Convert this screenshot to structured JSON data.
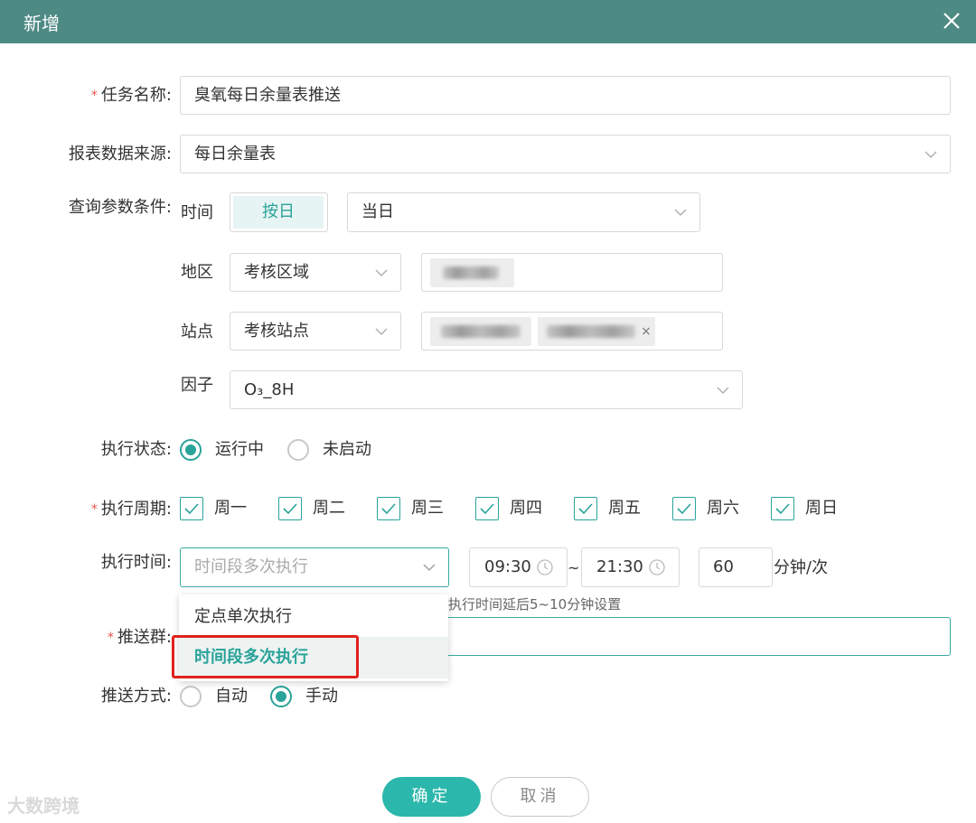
{
  "dialog": {
    "title": "新增"
  },
  "form": {
    "task_name": {
      "label": "任务名称:",
      "value": "臭氧每日余量表推送"
    },
    "report_source": {
      "label": "报表数据来源:",
      "value": "每日余量表"
    },
    "query": {
      "label": "查询参数条件:",
      "time": {
        "label": "时间",
        "button": "按日",
        "value": "当日"
      },
      "region": {
        "label": "地区",
        "type_value": "考核区域"
      },
      "site": {
        "label": "站点",
        "type_value": "考核站点",
        "tag_close": "×"
      },
      "factor": {
        "label": "因子",
        "value": "O₃_8H"
      }
    },
    "exec_status": {
      "label": "执行状态:",
      "options": [
        "运行中",
        "未启动"
      ],
      "selected": "运行中"
    },
    "exec_cycle": {
      "label": "执行周期:",
      "days": [
        "周一",
        "周二",
        "周三",
        "周四",
        "周五",
        "周六",
        "周日"
      ]
    },
    "exec_time": {
      "label": "执行时间:",
      "mode_placeholder": "时间段多次执行",
      "start": "09:30",
      "sep": "~",
      "end": "21:30",
      "interval": "60",
      "unit": "分钟/次",
      "hint_fragment": "执行时间延后5~10分钟设置",
      "options": [
        "定点单次执行",
        "时间段多次执行"
      ],
      "highlighted": "时间段多次执行"
    },
    "push_group": {
      "label": "推送群:"
    },
    "push_mode": {
      "label": "推送方式:",
      "options": [
        "自动",
        "手动"
      ],
      "selected": "手动"
    }
  },
  "actions": {
    "ok": "确定",
    "cancel": "取消"
  },
  "watermark": "大数跨境",
  "colors": {
    "header": "#4e8a84",
    "accent": "#2aa39a",
    "primary_button": "#2bb7ab",
    "highlight_border": "#e0211d"
  }
}
